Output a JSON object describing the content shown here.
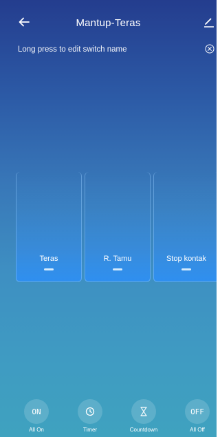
{
  "header": {
    "title": "Mantup-Teras",
    "back_icon": "arrow-left-icon",
    "edit_icon": "pencil-icon"
  },
  "hint": {
    "text": "Long press to edit switch name",
    "close_icon": "close-circle-icon"
  },
  "switches": [
    {
      "label": "Teras"
    },
    {
      "label": "R. Tamu"
    },
    {
      "label": "Stop kontak"
    }
  ],
  "actions": [
    {
      "icon_text": "ON",
      "label": "All On"
    },
    {
      "icon_text": "",
      "icon": "clock-icon",
      "label": "Timer"
    },
    {
      "icon_text": "",
      "icon": "hourglass-icon",
      "label": "Countdown"
    },
    {
      "icon_text": "OFF",
      "label": "All Off"
    }
  ],
  "colors": {
    "background_top": "#243d8e",
    "background_bottom": "#3fa2bf",
    "switch_active": "#2f8ff0"
  }
}
